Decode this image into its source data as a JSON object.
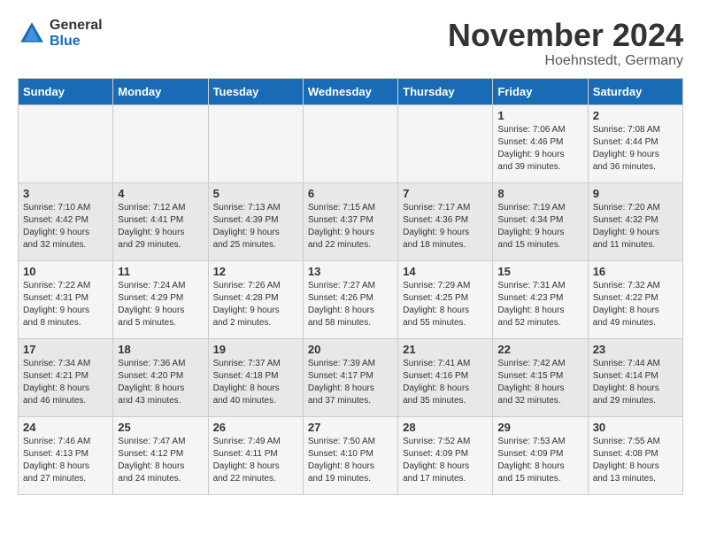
{
  "logo": {
    "general": "General",
    "blue": "Blue"
  },
  "title": "November 2024",
  "location": "Hoehnstedt, Germany",
  "days_of_week": [
    "Sunday",
    "Monday",
    "Tuesday",
    "Wednesday",
    "Thursday",
    "Friday",
    "Saturday"
  ],
  "weeks": [
    [
      {
        "day": "",
        "info": ""
      },
      {
        "day": "",
        "info": ""
      },
      {
        "day": "",
        "info": ""
      },
      {
        "day": "",
        "info": ""
      },
      {
        "day": "",
        "info": ""
      },
      {
        "day": "1",
        "info": "Sunrise: 7:06 AM\nSunset: 4:46 PM\nDaylight: 9 hours\nand 39 minutes."
      },
      {
        "day": "2",
        "info": "Sunrise: 7:08 AM\nSunset: 4:44 PM\nDaylight: 9 hours\nand 36 minutes."
      }
    ],
    [
      {
        "day": "3",
        "info": "Sunrise: 7:10 AM\nSunset: 4:42 PM\nDaylight: 9 hours\nand 32 minutes."
      },
      {
        "day": "4",
        "info": "Sunrise: 7:12 AM\nSunset: 4:41 PM\nDaylight: 9 hours\nand 29 minutes."
      },
      {
        "day": "5",
        "info": "Sunrise: 7:13 AM\nSunset: 4:39 PM\nDaylight: 9 hours\nand 25 minutes."
      },
      {
        "day": "6",
        "info": "Sunrise: 7:15 AM\nSunset: 4:37 PM\nDaylight: 9 hours\nand 22 minutes."
      },
      {
        "day": "7",
        "info": "Sunrise: 7:17 AM\nSunset: 4:36 PM\nDaylight: 9 hours\nand 18 minutes."
      },
      {
        "day": "8",
        "info": "Sunrise: 7:19 AM\nSunset: 4:34 PM\nDaylight: 9 hours\nand 15 minutes."
      },
      {
        "day": "9",
        "info": "Sunrise: 7:20 AM\nSunset: 4:32 PM\nDaylight: 9 hours\nand 11 minutes."
      }
    ],
    [
      {
        "day": "10",
        "info": "Sunrise: 7:22 AM\nSunset: 4:31 PM\nDaylight: 9 hours\nand 8 minutes."
      },
      {
        "day": "11",
        "info": "Sunrise: 7:24 AM\nSunset: 4:29 PM\nDaylight: 9 hours\nand 5 minutes."
      },
      {
        "day": "12",
        "info": "Sunrise: 7:26 AM\nSunset: 4:28 PM\nDaylight: 9 hours\nand 2 minutes."
      },
      {
        "day": "13",
        "info": "Sunrise: 7:27 AM\nSunset: 4:26 PM\nDaylight: 8 hours\nand 58 minutes."
      },
      {
        "day": "14",
        "info": "Sunrise: 7:29 AM\nSunset: 4:25 PM\nDaylight: 8 hours\nand 55 minutes."
      },
      {
        "day": "15",
        "info": "Sunrise: 7:31 AM\nSunset: 4:23 PM\nDaylight: 8 hours\nand 52 minutes."
      },
      {
        "day": "16",
        "info": "Sunrise: 7:32 AM\nSunset: 4:22 PM\nDaylight: 8 hours\nand 49 minutes."
      }
    ],
    [
      {
        "day": "17",
        "info": "Sunrise: 7:34 AM\nSunset: 4:21 PM\nDaylight: 8 hours\nand 46 minutes."
      },
      {
        "day": "18",
        "info": "Sunrise: 7:36 AM\nSunset: 4:20 PM\nDaylight: 8 hours\nand 43 minutes."
      },
      {
        "day": "19",
        "info": "Sunrise: 7:37 AM\nSunset: 4:18 PM\nDaylight: 8 hours\nand 40 minutes."
      },
      {
        "day": "20",
        "info": "Sunrise: 7:39 AM\nSunset: 4:17 PM\nDaylight: 8 hours\nand 37 minutes."
      },
      {
        "day": "21",
        "info": "Sunrise: 7:41 AM\nSunset: 4:16 PM\nDaylight: 8 hours\nand 35 minutes."
      },
      {
        "day": "22",
        "info": "Sunrise: 7:42 AM\nSunset: 4:15 PM\nDaylight: 8 hours\nand 32 minutes."
      },
      {
        "day": "23",
        "info": "Sunrise: 7:44 AM\nSunset: 4:14 PM\nDaylight: 8 hours\nand 29 minutes."
      }
    ],
    [
      {
        "day": "24",
        "info": "Sunrise: 7:46 AM\nSunset: 4:13 PM\nDaylight: 8 hours\nand 27 minutes."
      },
      {
        "day": "25",
        "info": "Sunrise: 7:47 AM\nSunset: 4:12 PM\nDaylight: 8 hours\nand 24 minutes."
      },
      {
        "day": "26",
        "info": "Sunrise: 7:49 AM\nSunset: 4:11 PM\nDaylight: 8 hours\nand 22 minutes."
      },
      {
        "day": "27",
        "info": "Sunrise: 7:50 AM\nSunset: 4:10 PM\nDaylight: 8 hours\nand 19 minutes."
      },
      {
        "day": "28",
        "info": "Sunrise: 7:52 AM\nSunset: 4:09 PM\nDaylight: 8 hours\nand 17 minutes."
      },
      {
        "day": "29",
        "info": "Sunrise: 7:53 AM\nSunset: 4:09 PM\nDaylight: 8 hours\nand 15 minutes."
      },
      {
        "day": "30",
        "info": "Sunrise: 7:55 AM\nSunset: 4:08 PM\nDaylight: 8 hours\nand 13 minutes."
      }
    ]
  ]
}
